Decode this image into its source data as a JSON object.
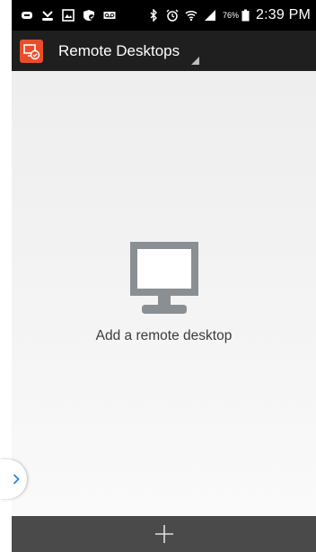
{
  "status_bar": {
    "battery_percent": "76%",
    "time": "2:39 PM",
    "icons_left": [
      "notification-icon",
      "missed-call-icon",
      "gallery-icon",
      "security-icon",
      "voicemail-icon"
    ],
    "icons_right": [
      "bluetooth-icon",
      "alarm-icon",
      "wifi-icon",
      "signal-icon",
      "battery-icon"
    ]
  },
  "action_bar": {
    "title": "Remote Desktops",
    "app_icon": "remote-desktop-app-icon",
    "accent_color": "#e94e2a"
  },
  "empty_state": {
    "icon": "monitor-icon",
    "label": "Add a remote desktop"
  },
  "drawer_tab": {
    "icon": "chevron-right-icon"
  },
  "bottom_bar": {
    "add_icon": "plus-icon"
  }
}
